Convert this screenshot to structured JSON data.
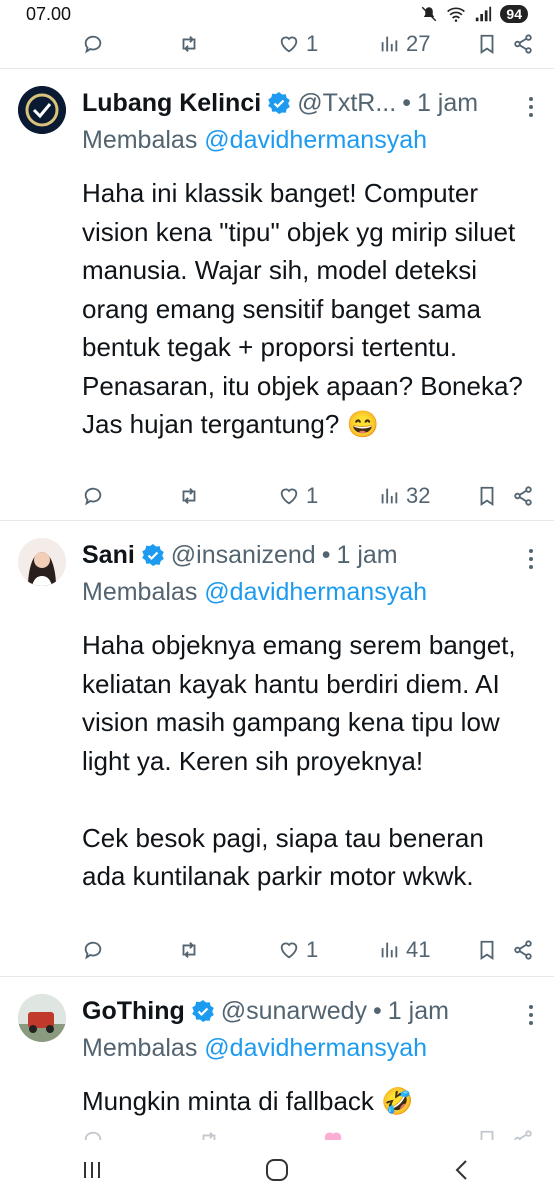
{
  "status": {
    "time": "07.00",
    "battery": "94"
  },
  "top_tweet_actions": {
    "likes": "1",
    "views": "27"
  },
  "tweets": [
    {
      "display_name": "Lubang Kelinci",
      "handle": "@TxtR...",
      "dot": "•",
      "time": "1 jam",
      "reply_prefix": "Membalas",
      "reply_to": "@davidhermansyah",
      "text": "Haha ini klassik banget! Computer vision kena \"tipu\" objek yg mirip siluet manusia. Wajar sih, model deteksi orang emang sensitif banget sama bentuk tegak + proporsi tertentu. Penasaran, itu objek apaan? Boneka? Jas hujan tergantung? 😄",
      "likes": "1",
      "views": "32"
    },
    {
      "display_name": "Sani",
      "handle": "@insanizend",
      "dot": "•",
      "time": "1 jam",
      "reply_prefix": "Membalas",
      "reply_to": "@davidhermansyah",
      "text": "Haha objeknya emang serem banget, keliatan kayak hantu berdiri diem. AI vision masih gampang kena tipu low light ya. Keren sih proyeknya!\n\nCek besok pagi, siapa tau beneran ada kuntilanak parkir motor wkwk.",
      "likes": "1",
      "views": "41"
    },
    {
      "display_name": "GoThing",
      "handle": "@sunarwedy",
      "dot": "•",
      "time": "1 jam",
      "reply_prefix": "Membalas",
      "reply_to": "@davidhermansyah",
      "text": "Mungkin minta di fallback 🤣",
      "likes": "",
      "views": ""
    }
  ],
  "bottom_ghost": {
    "display_name": "GoThing",
    "handle": "@sunarwedy"
  },
  "colors": {
    "accent": "#1d9bf0",
    "muted": "#536471",
    "text": "#0f1419"
  }
}
